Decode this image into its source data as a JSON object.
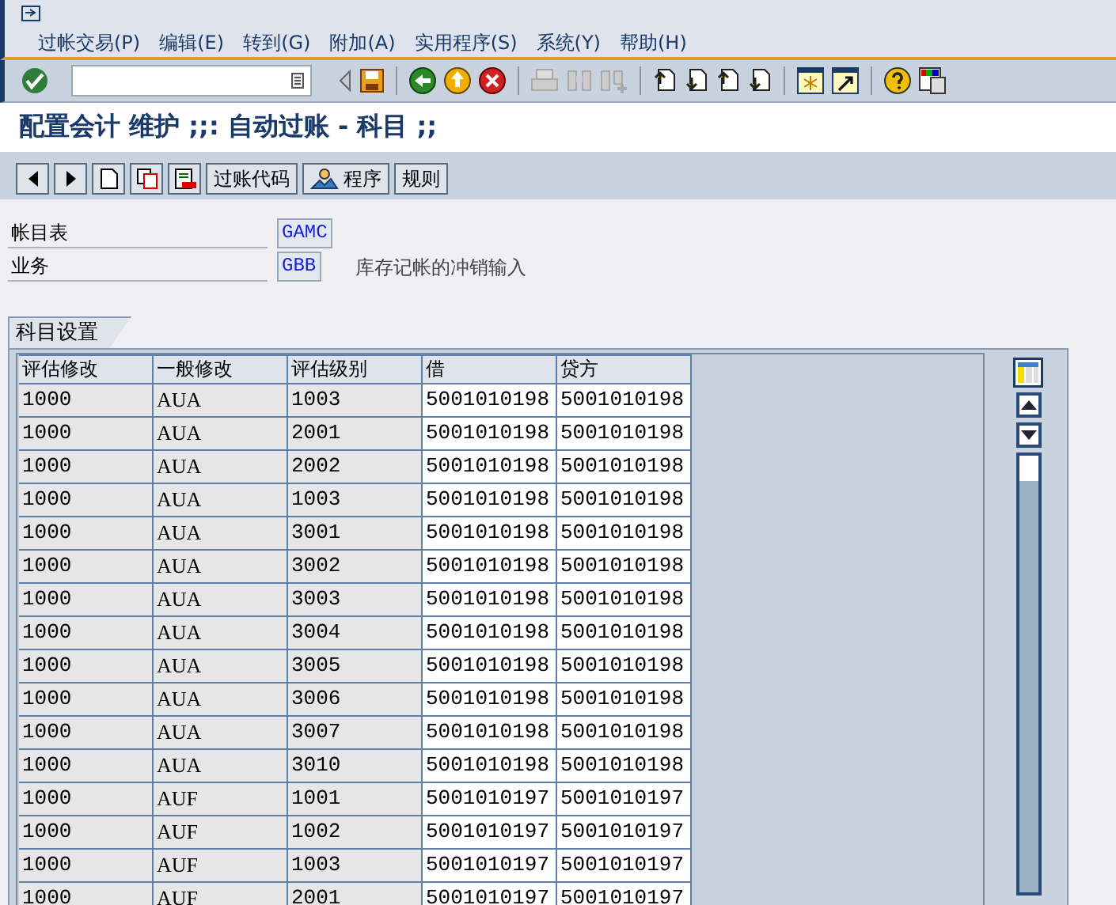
{
  "menu": [
    "过帐交易(P)",
    "编辑(E)",
    "转到(G)",
    "附加(A)",
    "实用程序(S)",
    "系统(Y)",
    "帮助(H)"
  ],
  "title": "配置会计 维护 ;;: 自动过账 - 科目 ;;",
  "app_toolbar": [
    {
      "kind": "prev"
    },
    {
      "kind": "next"
    },
    {
      "kind": "new"
    },
    {
      "kind": "copy"
    },
    {
      "kind": "delete"
    },
    {
      "kind": "text",
      "label": "过账代码"
    },
    {
      "kind": "icon_text",
      "label": "程序"
    },
    {
      "kind": "text",
      "label": "规则"
    }
  ],
  "fields": [
    {
      "label": "帐目表",
      "value": "GAMC"
    },
    {
      "label": "业务",
      "value": "GBB",
      "description": "库存记帐的冲销输入"
    }
  ],
  "tab": {
    "label": "科目设置"
  },
  "table": {
    "columns": [
      "评估修改",
      "一般修改",
      "评估级别",
      "借",
      "贷方"
    ],
    "rows": [
      [
        "1000",
        "AUA",
        "1003",
        "5001010198",
        "5001010198"
      ],
      [
        "1000",
        "AUA",
        "2001",
        "5001010198",
        "5001010198"
      ],
      [
        "1000",
        "AUA",
        "2002",
        "5001010198",
        "5001010198"
      ],
      [
        "1000",
        "AUA",
        "1003",
        "5001010198",
        "5001010198"
      ],
      [
        "1000",
        "AUA",
        "3001",
        "5001010198",
        "5001010198"
      ],
      [
        "1000",
        "AUA",
        "3002",
        "5001010198",
        "5001010198"
      ],
      [
        "1000",
        "AUA",
        "3003",
        "5001010198",
        "5001010198"
      ],
      [
        "1000",
        "AUA",
        "3004",
        "5001010198",
        "5001010198"
      ],
      [
        "1000",
        "AUA",
        "3005",
        "5001010198",
        "5001010198"
      ],
      [
        "1000",
        "AUA",
        "3006",
        "5001010198",
        "5001010198"
      ],
      [
        "1000",
        "AUA",
        "3007",
        "5001010198",
        "5001010198"
      ],
      [
        "1000",
        "AUA",
        "3010",
        "5001010198",
        "5001010198"
      ],
      [
        "1000",
        "AUF",
        "1001",
        "5001010197",
        "5001010197"
      ],
      [
        "1000",
        "AUF",
        "1002",
        "5001010197",
        "5001010197"
      ],
      [
        "1000",
        "AUF",
        "1003",
        "5001010197",
        "5001010197"
      ],
      [
        "1000",
        "AUF",
        "2001",
        "5001010197",
        "5001010197"
      ]
    ]
  }
}
